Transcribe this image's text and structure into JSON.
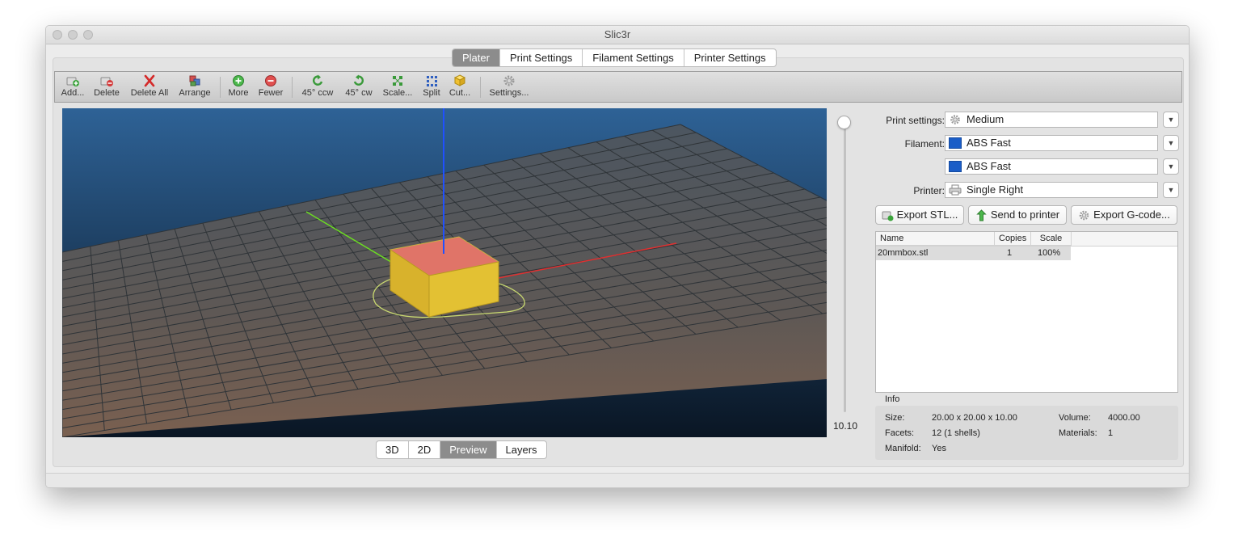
{
  "window": {
    "title": "Slic3r"
  },
  "tabs": [
    "Plater",
    "Print Settings",
    "Filament Settings",
    "Printer Settings"
  ],
  "toolbar": {
    "items": [
      {
        "label": "Add...",
        "icon": "add-brick-icon"
      },
      {
        "label": "Delete",
        "icon": "delete-brick-icon"
      },
      {
        "label": "Delete All",
        "icon": "cross-icon"
      },
      {
        "label": "Arrange",
        "icon": "arrange-icon"
      },
      {
        "label": "More",
        "icon": "plus-circle-icon"
      },
      {
        "label": "Fewer",
        "icon": "minus-circle-icon"
      },
      {
        "label": "45° ccw",
        "icon": "rotate-ccw-icon"
      },
      {
        "label": "45° cw",
        "icon": "rotate-cw-icon"
      },
      {
        "label": "Scale...",
        "icon": "scale-icon"
      },
      {
        "label": "Split",
        "icon": "split-icon"
      },
      {
        "label": "Cut...",
        "icon": "cut-cube-icon"
      },
      {
        "label": "Settings...",
        "icon": "gear-icon"
      }
    ]
  },
  "viewport": {
    "layer_height": "10.10"
  },
  "view_tabs": [
    "3D",
    "2D",
    "Preview",
    "Layers"
  ],
  "settings": {
    "print_label": "Print settings:",
    "print_value": "Medium",
    "filament_label": "Filament:",
    "filament_values": [
      "ABS Fast",
      "ABS Fast"
    ],
    "filament_color": "#1a5dc7",
    "printer_label": "Printer:",
    "printer_value": "Single Right"
  },
  "actions": {
    "export_stl": "Export STL...",
    "send": "Send to printer",
    "export_gcode": "Export G-code..."
  },
  "object_list": {
    "columns": [
      "Name",
      "Copies",
      "Scale"
    ],
    "rows": [
      {
        "name": "20mmbox.stl",
        "copies": "1",
        "scale": "100%"
      }
    ]
  },
  "info": {
    "title": "Info",
    "size_label": "Size:",
    "size": "20.00 x 20.00 x 10.00",
    "volume_label": "Volume:",
    "volume": "4000.00",
    "facets_label": "Facets:",
    "facets": "12 (1 shells)",
    "materials_label": "Materials:",
    "materials": "1",
    "manifold_label": "Manifold:",
    "manifold": "Yes"
  }
}
